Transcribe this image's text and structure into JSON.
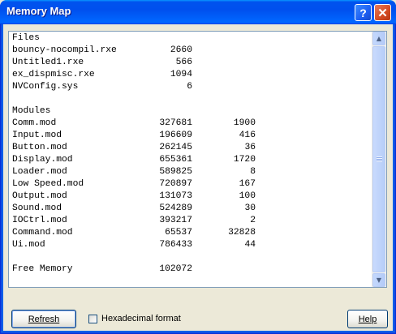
{
  "window": {
    "title": "Memory Map",
    "help_glyph": "?",
    "close_glyph": "✕"
  },
  "files": {
    "heading": "Files",
    "rows": [
      {
        "name": "bouncy-nocompil.rxe",
        "size": "2660"
      },
      {
        "name": "Untitled1.rxe",
        "size": "566"
      },
      {
        "name": "ex_dispmisc.rxe",
        "size": "1094"
      },
      {
        "name": "NVConfig.sys",
        "size": "6"
      }
    ]
  },
  "modules": {
    "heading": "Modules",
    "rows": [
      {
        "name": "Comm.mod",
        "id": "327681",
        "size": "1900"
      },
      {
        "name": "Input.mod",
        "id": "196609",
        "size": "416"
      },
      {
        "name": "Button.mod",
        "id": "262145",
        "size": "36"
      },
      {
        "name": "Display.mod",
        "id": "655361",
        "size": "1720"
      },
      {
        "name": "Loader.mod",
        "id": "589825",
        "size": "8"
      },
      {
        "name": "Low Speed.mod",
        "id": "720897",
        "size": "167"
      },
      {
        "name": "Output.mod",
        "id": "131073",
        "size": "100"
      },
      {
        "name": "Sound.mod",
        "id": "524289",
        "size": "30"
      },
      {
        "name": "IOCtrl.mod",
        "id": "393217",
        "size": "2"
      },
      {
        "name": "Command.mod",
        "id": "65537",
        "size": "32828"
      },
      {
        "name": "Ui.mod",
        "id": "786433",
        "size": "44"
      }
    ]
  },
  "free_memory": {
    "label": "Free Memory",
    "value": "102072"
  },
  "controls": {
    "refresh_label": "Refresh",
    "hex_label": "Hexadecimal format",
    "hex_checked": false,
    "help_label": "Help"
  },
  "icons": {
    "scroll_up": "up-arrow-icon",
    "scroll_down": "down-arrow-icon"
  },
  "colors": {
    "titlebar": "#0054e3",
    "listbox_border": "#7f9db9",
    "dialog_bg": "#ece9d8"
  }
}
